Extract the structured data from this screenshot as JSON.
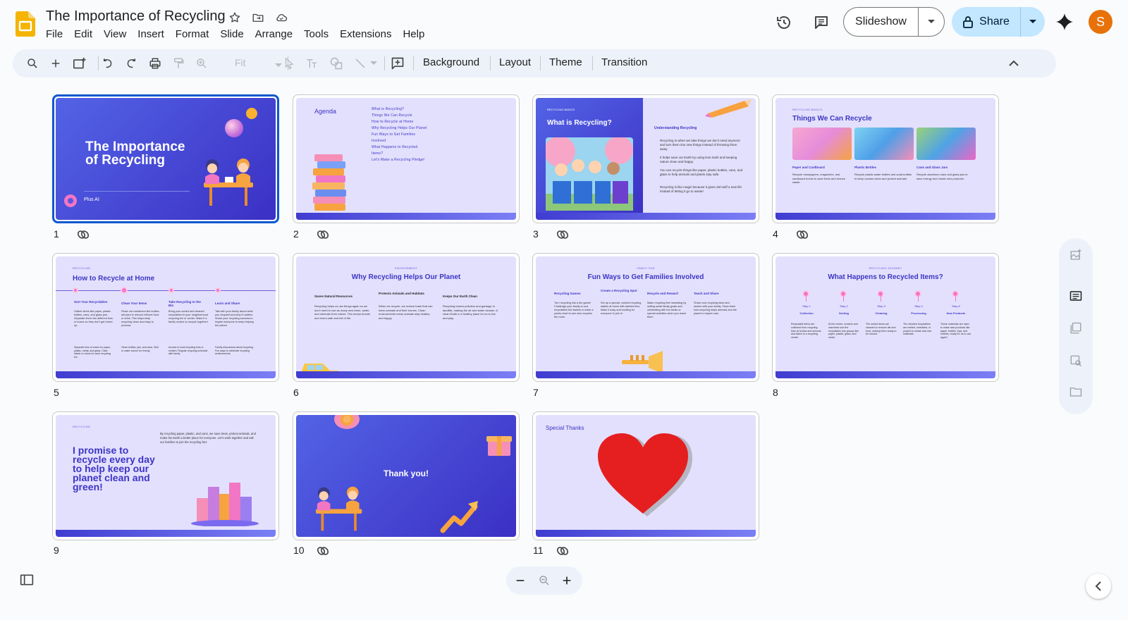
{
  "app": {
    "title": "The Importance of Recycling",
    "menu": [
      "File",
      "Edit",
      "View",
      "Insert",
      "Format",
      "Slide",
      "Arrange",
      "Tools",
      "Extensions",
      "Help"
    ],
    "slideshow_label": "Slideshow",
    "share_label": "Share",
    "avatar_letter": "S"
  },
  "toolbar": {
    "zoom_value": "Fit",
    "background_label": "Background",
    "layout_label": "Layout",
    "theme_label": "Theme",
    "transition_label": "Transition"
  },
  "slides": {
    "s1": {
      "num": "1",
      "title": "The Importance of Recycling",
      "author": "Plus AI"
    },
    "s2": {
      "num": "2",
      "title": "Agenda",
      "items": [
        "What is Recycling?",
        "Things We Can Recycle",
        "How to Recycle at Home",
        "Why Recycling Helps Our Planet",
        "Fun Ways to Get Families Involved",
        "What Happens to Recycled Items?",
        "Let's Make a Recycling Pledge!"
      ]
    },
    "s3": {
      "num": "3",
      "section": "RECYCLING BASICS",
      "title": "What is Recycling?",
      "subtitle": "Understanding Recycling",
      "bullets": [
        "Recycling is when we take things we don't need anymore and turn them into new things instead of throwing them away.",
        "It helps save our Earth by using less trash and keeping nature clean and happy.",
        "You can recycle things like paper, plastic bottles, cans, and glass to help animals and plants stay safe.",
        "Recycling is like magic because it gives old stuff a new life instead of letting it go to waste!"
      ]
    },
    "s4": {
      "num": "4",
      "section": "RECYCLING BASICS",
      "title": "Things We Can Recycle",
      "cols": [
        {
          "h": "Paper and Cardboard",
          "t": "Recycle newspapers, magazines, and cardboard boxes to save trees and reduce waste."
        },
        {
          "h": "Plastic Bottles",
          "t": "Recycle plastic water bottles and soda bottles to keep oceans clean and protect animals."
        },
        {
          "h": "Cans and Glass Jars",
          "t": "Recycle aluminum cans and glass jars to save energy and create new products."
        }
      ]
    },
    "s5": {
      "num": "5",
      "section": "RECYCLING",
      "title": "How to Recycle at Home",
      "cols": [
        {
          "h": "Sort Your Recyclables",
          "t": "Gather items like paper, plastic bottles, cans, and glass jars. Separate them into different bins or boxes so they don't get mixed up.",
          "n": "Separate bins or boxes for paper, plastic, metal, and glass. Clear labels or colors for each recycling bin"
        },
        {
          "h": "Clean Your Items",
          "t": "Rinse out containers like bottles and jars to remove leftover food or drink. This helps keep recycling clean and easy to process.",
          "n": "Clean bottles, jars, and cans. Sink or water source for rinsing"
        },
        {
          "h": "Take Recycling to the Bin",
          "t": "Bring your sorted and cleaned recyclables to your neighborhood recycling bin or center. Make it a family routine to recycle together!",
          "n": "Access to local recycling bins or centers. Regular recycling schedule with family"
        },
        {
          "h": "Learn and Share",
          "t": "Talk with your family about what you recycled and why it matters. Share your recycling success to inspire everyone to keep helping the planet.",
          "n": "Family discussions about recycling. Fun ways to celebrate recycling achievements"
        }
      ]
    },
    "s6": {
      "num": "6",
      "section": "ENVIRONMENT",
      "title": "Why Recycling Helps Our Planet",
      "cols": [
        {
          "h": "Saves Natural Resources",
          "t": "Recycling helps us use things again so we don't need to use as many new trees, water, and minerals from nature. This keeps forests and rivers safe and full of life."
        },
        {
          "h": "Protects Animals and Habitats",
          "t": "When we recycle, we reduce trash that can harm animals and their homes. Clean environments mean animals stay healthy and happy."
        },
        {
          "h": "Keeps Our Earth Clean",
          "t": "Recycling lowers pollution and garbage in landfills, making the air and water cleaner. A clean Earth is a healthy place for us to live and play."
        }
      ]
    },
    "s7": {
      "num": "7",
      "section": "FAMILY FUN",
      "title": "Fun Ways to Get Families Involved",
      "cols": [
        {
          "h": "Recycling Games",
          "t": "Turn recycling into a fun game! Challenge your family to sort recyclables the fastest or make a points chart to see who recycles the most."
        },
        {
          "h": "Create a Recycling Spot",
          "t": "Set up a special, colorful recycling station at home with labeled bins. Make it easy and exciting for everyone to join in."
        },
        {
          "h": "Recycle and Reward",
          "t": "Make recycling feel rewarding by setting small family goals and celebrating with fun treats or special activities when you reach them."
        },
        {
          "h": "Teach and Share",
          "t": "Share cool recycling facts and stories with your family. Show them how recycling helps animals and the planet to inspire care."
        }
      ]
    },
    "s8": {
      "num": "8",
      "section": "RECYCLING JOURNEY",
      "title": "What Happens to Recycled Items?",
      "steps": [
        {
          "s": "Step 1",
          "n": "Collection",
          "t": "Recyclable items are collected from recycling bins at homes and schools and taken to a recycling center."
        },
        {
          "s": "Step 2",
          "n": "Sorting",
          "t": "At the center, workers and machines sort the recyclables into groups like paper, plastic, glass, and metal."
        },
        {
          "s": "Step 3",
          "n": "Cleaning",
          "t": "The sorted items are cleaned to remove dirt and food, making them ready to be reused."
        },
        {
          "s": "Step 4",
          "n": "Processing",
          "t": "The cleaned recyclables are melted, shredded, or pulped to create new raw materials."
        },
        {
          "s": "Step 5",
          "n": "New Products",
          "t": "These materials are used to make new products like paper, bottles, toys, and clothes, ready for us to use again!"
        }
      ]
    },
    "s9": {
      "num": "9",
      "section": "RECYCLING",
      "title": "I promise to recycle every day to help keep our planet clean and green!",
      "text": "By recycling paper, plastic, and cans, we save trees, protect animals, and make the Earth a better place for everyone. Let's work together and ask our families to join the recycling fun!"
    },
    "s10": {
      "num": "10",
      "title": "Thank you!"
    },
    "s11": {
      "num": "11",
      "title": "Special Thanks"
    }
  },
  "colors": {
    "accent": "#0b57d0",
    "slide_bg": "#e3e0fd",
    "slide_text": "#3d35c4",
    "dark_slide": "#4a47d6",
    "share_bg": "#c2e7ff",
    "avatar": "#e8710a",
    "heart": "#e51f1f"
  },
  "icons": [
    "google-slides-logo",
    "star-icon",
    "move-to-folder-icon",
    "cloud-saved-icon",
    "version-history-icon",
    "comment-icon",
    "lock-icon",
    "gemini-icon",
    "search-icon",
    "plus-icon",
    "new-slide-icon",
    "undo-icon",
    "redo-icon",
    "print-icon",
    "paint-format-icon",
    "zoom-icon",
    "select-icon",
    "text-box-icon",
    "shape-icon",
    "line-icon",
    "comment-add-icon",
    "collapse-toolbar-icon",
    "link-icon"
  ]
}
